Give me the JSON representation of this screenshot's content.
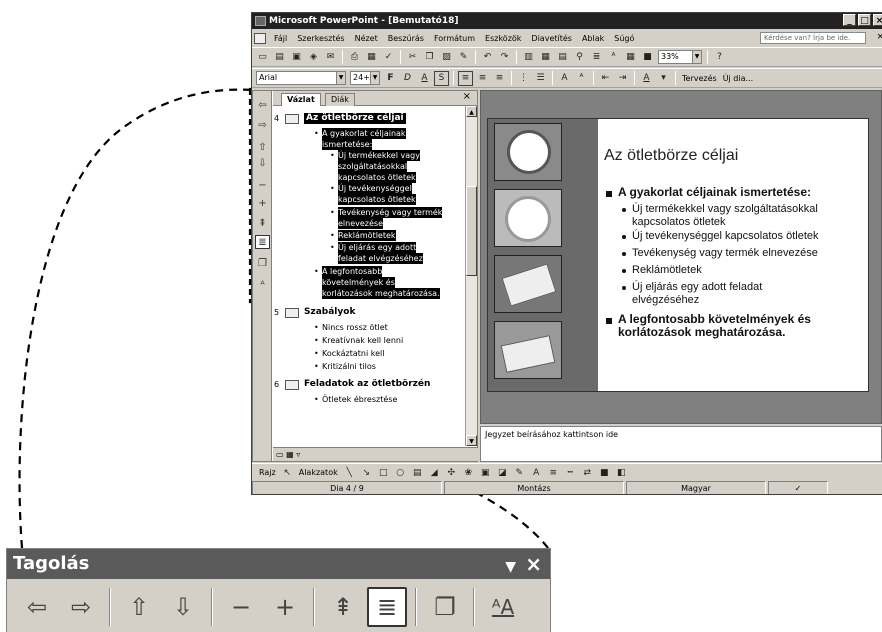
{
  "window": {
    "title": "Microsoft PowerPoint - [Bemutató18]",
    "controls": [
      "_",
      "□",
      "×"
    ]
  },
  "menu": {
    "items": [
      "Fájl",
      "Szerkesztés",
      "Nézet",
      "Beszúrás",
      "Formátum",
      "Eszközök",
      "Diavetítés",
      "Ablak",
      "Súgó"
    ],
    "help_placeholder": "Kérdése van? Írja be ide.",
    "doc_close": "×"
  },
  "toolbar1": {
    "zoom": "33%",
    "help_icon": "?"
  },
  "toolbar2": {
    "font": "Arial",
    "size": "24+",
    "bold": "F",
    "italic": "D",
    "underline": "A",
    "shadow": "S",
    "design": "Tervezés",
    "new_slide": "Új dia..."
  },
  "outline_pane": {
    "tabs": [
      "Vázlat",
      "Diák"
    ],
    "close": "×",
    "slides": [
      {
        "num": "4",
        "title": "Az ötletbörze céljai",
        "lines": [
          "A gyakorlat céljainak",
          "ismertetése:",
          "Új termékekkel vagy",
          "szolgáltatásokkal",
          "kapcsolatos ötletek",
          "Új tevékenységgel",
          "kapcsolatos ötletek",
          "Tevékenység vagy termék",
          "elnevezése",
          "Reklámötletek",
          "Új eljárás egy adott",
          "feladat elvégzéséhez",
          "A legfontosabb",
          "követelmények és",
          "korlátozások meghatározása."
        ]
      },
      {
        "num": "5",
        "title": "Szabályok",
        "lines": [
          "Nincs rossz ötlet",
          "Kreatívnak kell lenni",
          "Kockáztatni kell",
          "Kritizálni tilos"
        ]
      },
      {
        "num": "6",
        "title": "Feladatok az ötletbörzén",
        "lines": [
          "Ötletek ébresztése"
        ]
      }
    ]
  },
  "slide": {
    "title": "Az ötletbörze céljai",
    "bullets": [
      {
        "level": 1,
        "text": "A gyakorlat céljainak ismertetése:"
      },
      {
        "level": 2,
        "text": "Új termékekkel vagy szolgáltatásokkal\nkapcsolatos ötletek"
      },
      {
        "level": 2,
        "text": "Új tevékenységgel kapcsolatos ötletek"
      },
      {
        "level": 2,
        "text": "Tevékenység vagy termék elnevezése"
      },
      {
        "level": 2,
        "text": "Reklámötletek"
      },
      {
        "level": 2,
        "text": "Új eljárás egy adott feladat\nelvégzéséhez"
      },
      {
        "level": 1,
        "text": "A legfontosabb követelmények és\nkorlátozások meghatározása."
      }
    ]
  },
  "notes": {
    "placeholder": "Jegyzet beírásához kattintson ide"
  },
  "drawing_bar": {
    "draw": "Rajz",
    "autoshapes": "Alakzatok"
  },
  "status": {
    "slide": "Dia 4 / 9",
    "design": "Montázs",
    "language": "Magyar"
  },
  "tagolas": {
    "title": "Tagolás",
    "menu": "▼",
    "close": "×",
    "buttons": [
      "Előléptetés",
      "Lefokozás",
      "Feljebb",
      "Lejjebb",
      "Összecsukás",
      "Kibontás",
      "Összes összecsukása",
      "Összes kibontása",
      "Összefoglaló dia",
      "Formázás megjelenítése"
    ]
  }
}
